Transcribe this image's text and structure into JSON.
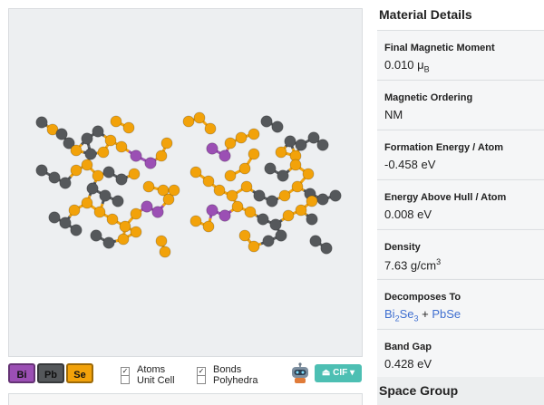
{
  "toolbar": {
    "elements": [
      "Bi",
      "Pb",
      "Se"
    ],
    "options": {
      "atoms": "Atoms",
      "unit_cell": "Unit Cell",
      "bonds": "Bonds",
      "polyhedra": "Polyhedra"
    },
    "checked": {
      "atoms": true,
      "unit_cell": false,
      "bonds": true,
      "polyhedra": false
    },
    "download_label": "CIF"
  },
  "colors": {
    "bi": "#9b4fb4",
    "pb": "#55585b",
    "se": "#f2a20a",
    "cif_button": "#4dbfb3",
    "link": "#3f6fd0"
  },
  "details": {
    "title": "Material Details",
    "magnetic_moment": {
      "label": "Final Magnetic Moment",
      "value": "0.010",
      "unit": "μ",
      "unit_sub": "B"
    },
    "magnetic_ordering": {
      "label": "Magnetic Ordering",
      "value": "NM"
    },
    "formation_energy": {
      "label": "Formation Energy / Atom",
      "value": "-0.458 eV"
    },
    "energy_above_hull": {
      "label": "Energy Above Hull / Atom",
      "value": "0.008 eV"
    },
    "density": {
      "label": "Density",
      "value": "7.63 g/cm",
      "sup": "3"
    },
    "decomposes_to": {
      "label": "Decomposes To",
      "first": {
        "base": "Bi",
        "sub1": "2",
        "mid": "Se",
        "sub2": "3"
      },
      "plus": " + ",
      "second": "PbSe"
    },
    "band_gap": {
      "label": "Band Gap",
      "value": "0.428 eV"
    },
    "space_group_title": "Space Group"
  }
}
